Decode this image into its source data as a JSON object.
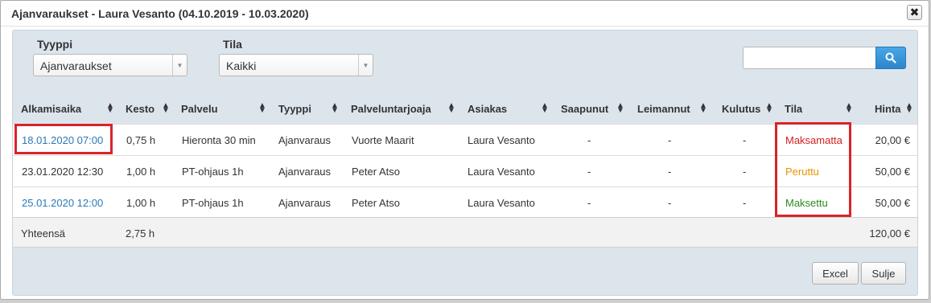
{
  "dialog": {
    "title": "Ajanvaraukset - Laura Vesanto (04.10.2019 - 10.03.2020)",
    "close_label": "✖"
  },
  "filters": {
    "type_label": "Tyyppi",
    "type_value": "Ajanvaraukset",
    "status_label": "Tila",
    "status_value": "Kaikki",
    "search_placeholder": ""
  },
  "table": {
    "headers": [
      "Alkamisaika",
      "Kesto",
      "Palvelu",
      "Tyyppi",
      "Palveluntarjoaja",
      "Asiakas",
      "Saapunut",
      "Leimannut",
      "Kulutus",
      "Tila",
      "Hinta"
    ],
    "rows": [
      {
        "start": "18.01.2020 07:00",
        "duration": "0,75 h",
        "service": "Hieronta 30 min",
        "type": "Ajanvaraus",
        "provider": "Vuorte Maarit",
        "customer": "Laura Vesanto",
        "arrived": "-",
        "stamped": "-",
        "consumption": "-",
        "status": "Maksamatta",
        "price": "20,00 €"
      },
      {
        "start": "23.01.2020 12:30",
        "duration": "1,00 h",
        "service": "PT-ohjaus 1h",
        "type": "Ajanvaraus",
        "provider": "Peter Atso",
        "customer": "Laura Vesanto",
        "arrived": "-",
        "stamped": "-",
        "consumption": "-",
        "status": "Peruttu",
        "price": "50,00 €"
      },
      {
        "start": "25.01.2020 12:00",
        "duration": "1,00 h",
        "service": "PT-ohjaus 1h",
        "type": "Ajanvaraus",
        "provider": "Peter Atso",
        "customer": "Laura Vesanto",
        "arrived": "-",
        "stamped": "-",
        "consumption": "-",
        "status": "Maksettu",
        "price": "50,00 €"
      }
    ],
    "total": {
      "label": "Yhteensä",
      "duration": "2,75 h",
      "price": "120,00 €"
    }
  },
  "footer": {
    "excel_label": "Excel",
    "close_label": "Sulje"
  },
  "colors": {
    "link": "#2a79b8",
    "status_unpaid": "#d21f1f",
    "status_cancelled": "#e69500",
    "status_paid": "#2a8a1e",
    "highlight": "#d9232b",
    "search_button": "#2a86cc"
  }
}
